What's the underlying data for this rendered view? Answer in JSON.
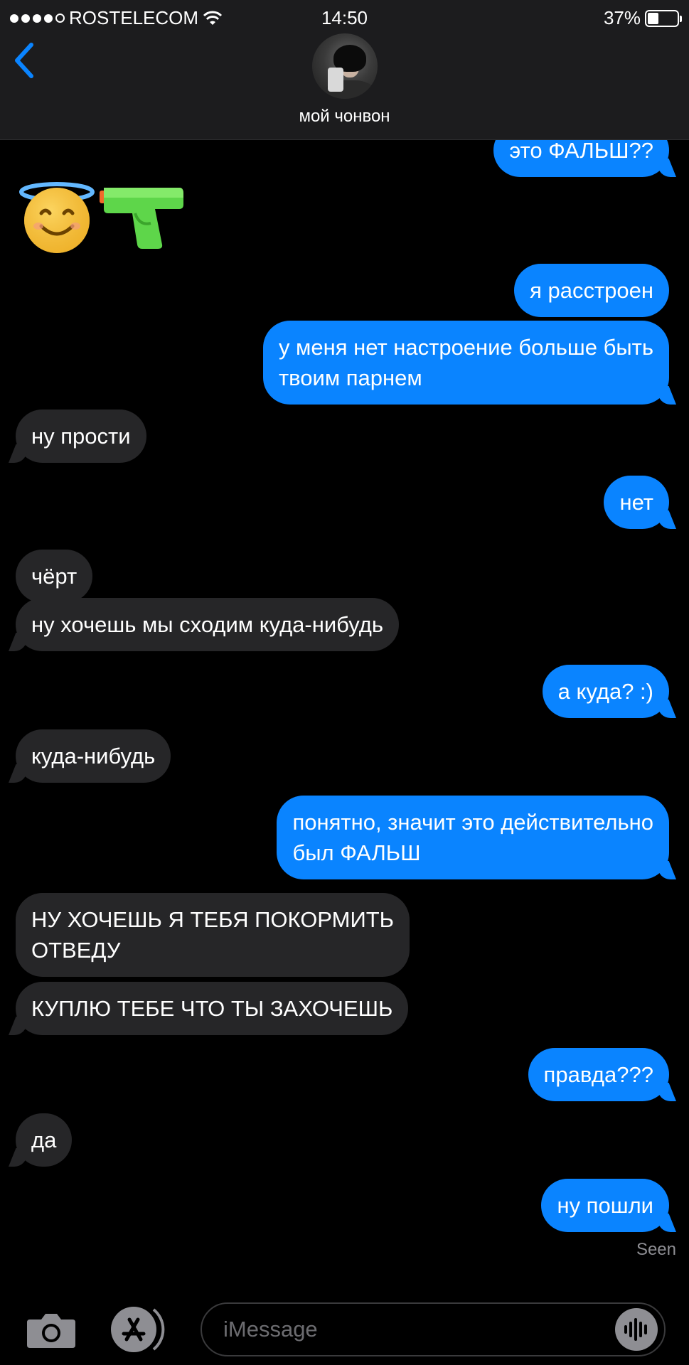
{
  "status_bar": {
    "carrier": "ROSTELECOM",
    "time": "14:50",
    "battery": "37%",
    "battery_level": 0.37
  },
  "header": {
    "contact_name": "мой чонвон"
  },
  "messages": [
    {
      "from": "me",
      "text": "это ФАЛЬШ??"
    },
    {
      "from": "them",
      "type": "emoji",
      "emoji": [
        "smiling-face-with-halo",
        "water-pistol"
      ]
    },
    {
      "from": "me",
      "text": "я расстроен"
    },
    {
      "from": "me",
      "text": "у меня нет настроение больше быть\nтвоим парнем"
    },
    {
      "from": "them",
      "text": "ну прости"
    },
    {
      "from": "me",
      "text": "нет"
    },
    {
      "from": "them",
      "text": "чёрт"
    },
    {
      "from": "them",
      "text": "ну хочешь мы сходим куда-нибудь"
    },
    {
      "from": "me",
      "text": "а куда? :)"
    },
    {
      "from": "them",
      "text": "куда-нибудь"
    },
    {
      "from": "me",
      "text": "понятно, значит это действительно\nбыл ФАЛЬШ"
    },
    {
      "from": "them",
      "text": "НУ ХОЧЕШЬ Я ТЕБЯ ПОКОРМИТЬ\nОТВЕДУ"
    },
    {
      "from": "them",
      "text": "КУПЛЮ ТЕБЕ ЧТО ТЫ ЗАХОЧЕШЬ"
    },
    {
      "from": "me",
      "text": "правда???"
    },
    {
      "from": "them",
      "text": "да"
    },
    {
      "from": "me",
      "text": "ну пошли"
    }
  ],
  "receipt": "Seen",
  "input": {
    "placeholder": "iMessage"
  },
  "colors": {
    "outgoing_bubble": "#0a84ff",
    "incoming_bubble": "#262628",
    "background": "#000000",
    "header_bg": "#1c1c1e"
  },
  "icons": [
    "back-chevron-icon",
    "wifi-icon",
    "battery-icon",
    "camera-icon",
    "app-store-icon",
    "audio-waveform-icon"
  ]
}
